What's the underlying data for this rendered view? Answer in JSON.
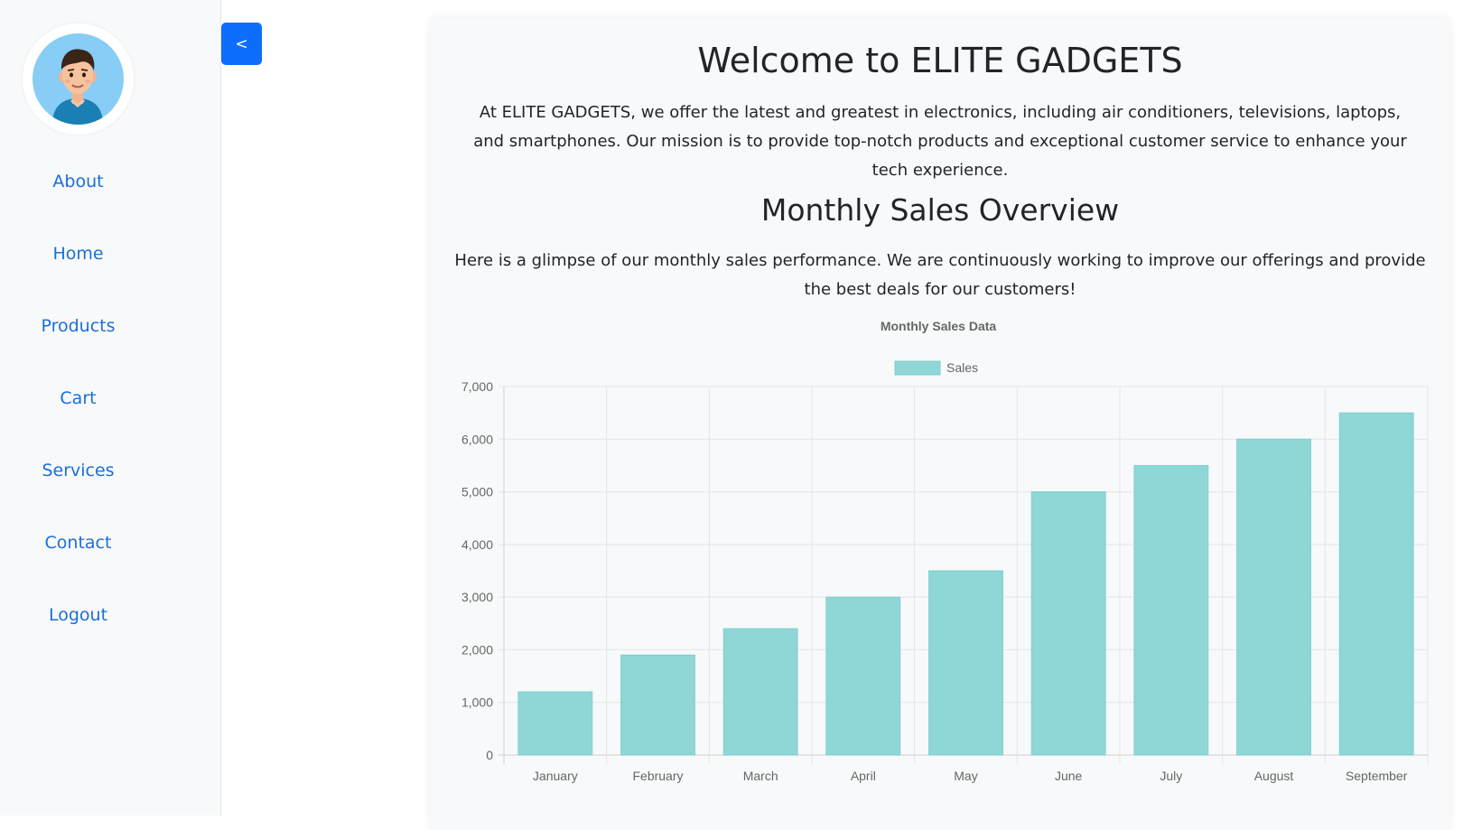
{
  "sidebar": {
    "items": [
      {
        "label": "About"
      },
      {
        "label": "Home"
      },
      {
        "label": "Products"
      },
      {
        "label": "Cart"
      },
      {
        "label": "Services"
      },
      {
        "label": "Contact"
      },
      {
        "label": "Logout"
      }
    ]
  },
  "toggle": {
    "label": "<"
  },
  "main": {
    "welcome_title": "Welcome to ELITE GADGETS",
    "welcome_text": "At ELITE GADGETS, we offer the latest and greatest in electronics, including air conditioners, televisions, laptops, and smartphones. Our mission is to provide top-notch products and exceptional customer service to enhance your tech experience.",
    "overview_title": "Monthly Sales Overview",
    "overview_text": "Here is a glimpse of our monthly sales performance. We are continuously working to improve our offerings and provide the best deals for our customers!"
  },
  "colors": {
    "accent": "#0d6efd",
    "link": "#1a6fd9",
    "bar_fill": "#8fd7d7",
    "bar_stroke": "#7fcfcf"
  },
  "chart_data": {
    "type": "bar",
    "title": "Monthly Sales Data",
    "categories": [
      "January",
      "February",
      "March",
      "April",
      "May",
      "June",
      "July",
      "August",
      "September"
    ],
    "series": [
      {
        "name": "Sales",
        "values": [
          1200,
          1900,
          2400,
          3000,
          3500,
          5000,
          5500,
          6000,
          6500
        ]
      }
    ],
    "ylim": [
      0,
      7000
    ],
    "yticks": [
      "0",
      "1,000",
      "2,000",
      "3,000",
      "4,000",
      "5,000",
      "6,000",
      "7,000"
    ],
    "grid": true,
    "legend": "top"
  }
}
